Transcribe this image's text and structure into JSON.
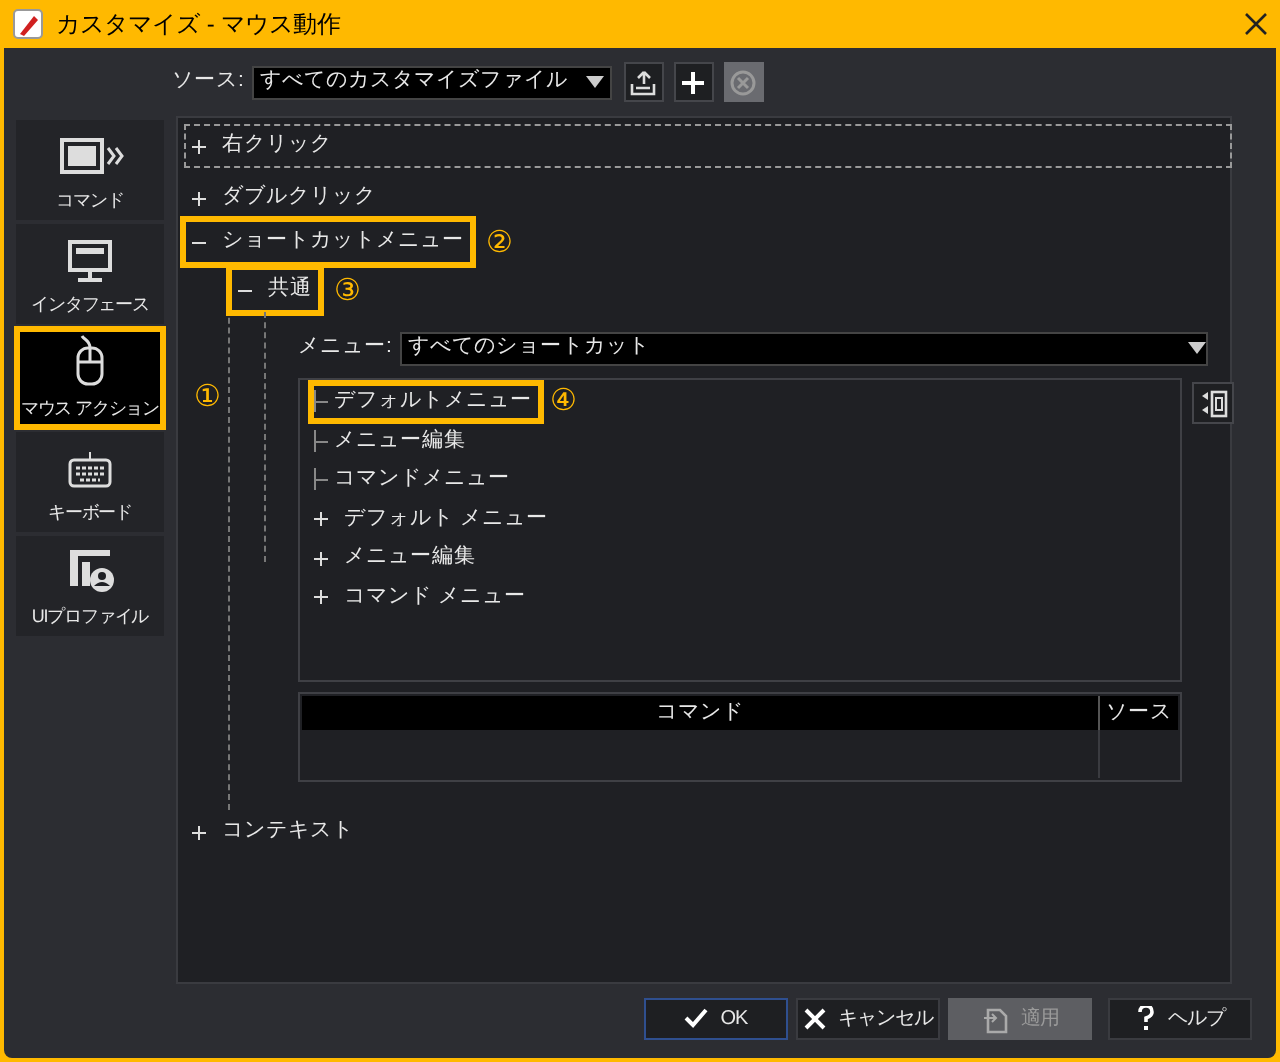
{
  "window": {
    "title": "カスタマイズ - マウス動作"
  },
  "source": {
    "label": "ソース:",
    "value": "すべてのカスタマイズファイル",
    "buttons": [
      {
        "kind": "export",
        "disabled": false
      },
      {
        "kind": "add",
        "disabled": false
      },
      {
        "kind": "remove",
        "disabled": true
      }
    ]
  },
  "sidebar": {
    "items": [
      {
        "label": "コマンド",
        "kind": "command",
        "selected": false,
        "highlighted": false
      },
      {
        "label": "インタフェース",
        "kind": "interface",
        "selected": false,
        "highlighted": false
      },
      {
        "label": "マウス アクション",
        "kind": "mouse",
        "selected": true,
        "highlighted": true,
        "annotation": "①"
      },
      {
        "label": "キーボード",
        "kind": "keyboard",
        "selected": false,
        "highlighted": false
      },
      {
        "label": "UIプロファイル",
        "kind": "profile",
        "selected": false,
        "highlighted": false
      }
    ]
  },
  "tree": [
    {
      "label": "右クリック",
      "expanded": false,
      "focused": true,
      "highlighted": false
    },
    {
      "label": "ダブルクリック",
      "expanded": false,
      "focused": false,
      "highlighted": false
    },
    {
      "label": "ショートカットメニュー",
      "expanded": true,
      "focused": false,
      "highlighted": true,
      "annotation": "②",
      "children": [
        {
          "label": "共通",
          "expanded": true,
          "focused": false,
          "highlighted": true,
          "annotation": "③"
        }
      ]
    },
    {
      "label": "コンテキスト",
      "expanded": false,
      "focused": false,
      "highlighted": false
    }
  ],
  "menu_panel": {
    "label": "メニュー:",
    "value": "すべてのショートカット",
    "items": [
      {
        "label": "デフォルトメニュー",
        "kind": "leaf",
        "highlighted": true,
        "annotation": "④"
      },
      {
        "label": "メニュー編集",
        "kind": "leaf",
        "highlighted": false
      },
      {
        "label": "コマンドメニュー",
        "kind": "leaf",
        "highlighted": false
      },
      {
        "label": "デフォルト メニュー",
        "kind": "group",
        "expanded": false,
        "highlighted": false
      },
      {
        "label": "メニュー編集",
        "kind": "group",
        "expanded": false,
        "highlighted": false
      },
      {
        "label": "コマンド メニュー",
        "kind": "group",
        "expanded": false,
        "highlighted": false
      }
    ],
    "table": {
      "columns": [
        "コマンド",
        "ソース"
      ]
    }
  },
  "buttons": [
    {
      "label": "OK",
      "kind": "ok",
      "disabled": false,
      "default": true
    },
    {
      "label": "キャンセル",
      "kind": "cancel",
      "disabled": false,
      "default": false
    },
    {
      "label": "適用",
      "kind": "apply",
      "disabled": true,
      "default": false
    },
    {
      "label": "ヘルプ",
      "kind": "help",
      "disabled": false,
      "default": false
    }
  ]
}
